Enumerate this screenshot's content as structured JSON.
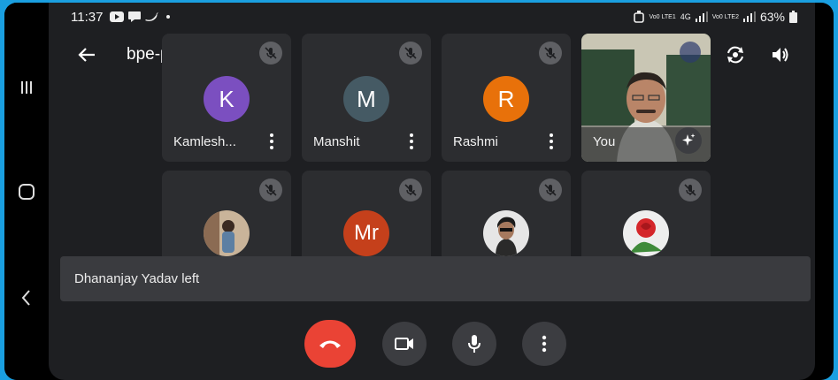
{
  "status": {
    "time": "11:37",
    "carrier1": "Vo0 LTE1",
    "network": "4G",
    "carrier2": "Vo0 LTE2",
    "battery": "63%"
  },
  "meeting": {
    "code": "bpe-pfri-gut"
  },
  "participants": [
    {
      "name": "Kamlesh...",
      "initial": "K",
      "color": "#7b4fc0"
    },
    {
      "name": "Manshit",
      "initial": "M",
      "color": "#455a64"
    },
    {
      "name": "Rashmi",
      "initial": "R",
      "color": "#e8710a"
    },
    {
      "name": "You"
    },
    {
      "name": ""
    },
    {
      "name": "",
      "initial": "Mr",
      "color": "#c5401b"
    },
    {
      "name": ""
    },
    {
      "name": ""
    }
  ],
  "toast": {
    "message": "Dhananjay Yadav left"
  },
  "colors": {
    "end_call": "#ea4335",
    "control_bg": "#3c3d41",
    "screen_bg": "#1e1f22",
    "tile_bg": "#2c2d30"
  }
}
